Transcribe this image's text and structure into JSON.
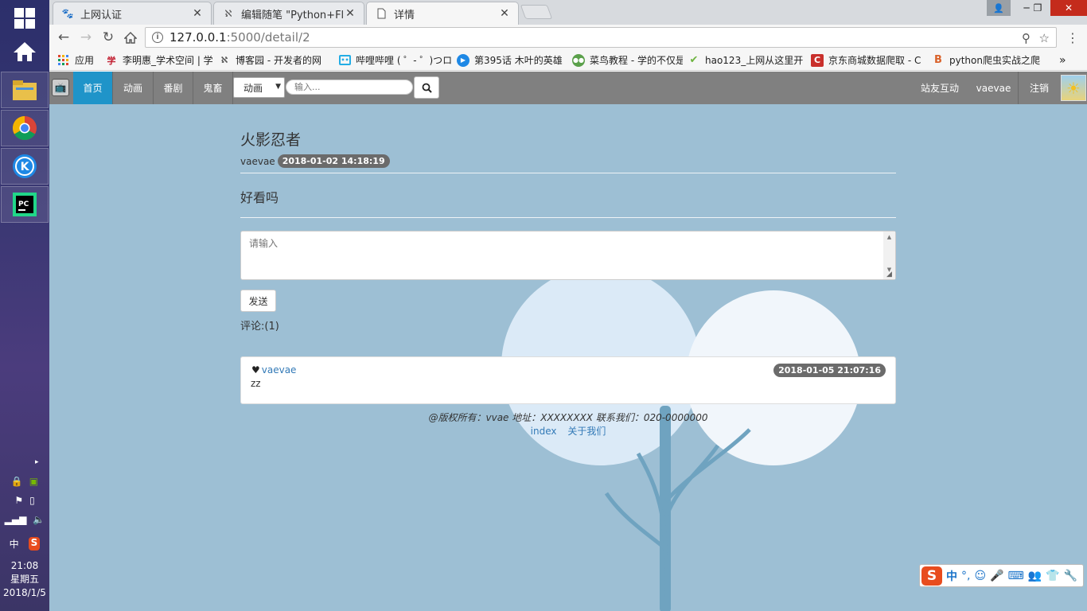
{
  "taskbar": {
    "clock_time": "21:08",
    "clock_weekday": "星期五",
    "clock_date": "2018/1/5",
    "tray_ime": "中",
    "tray_sogou": "S"
  },
  "browser": {
    "tabs": [
      {
        "title": "上网认证",
        "icon": "paw-icon"
      },
      {
        "title": "编辑随笔 \"Python+Flask",
        "icon": "cnblogs-icon"
      },
      {
        "title": "详情",
        "icon": "document-icon"
      }
    ],
    "url_host": "127.0.0.1",
    "url_path": ":5000/detail/2",
    "bookmarks": [
      {
        "label": "应用",
        "icon": "apps-grid-icon",
        "color": "#e0452f"
      },
      {
        "label": "李明惠_学术空间 | 学",
        "icon": "scholar-icon",
        "color": "#c0192c"
      },
      {
        "label": "博客园 - 开发者的网",
        "icon": "cnblogs-icon",
        "color": "#555555"
      },
      {
        "label": "哔哩哔哩 ( ゜- ゜)つロ",
        "icon": "bilibili-icon",
        "color": "#23ade5"
      },
      {
        "label": "第395话 木叶的英雄",
        "icon": "video-play-icon",
        "color": "#1e88e5"
      },
      {
        "label": "菜鸟教程 - 学的不仅是",
        "icon": "runoob-icon",
        "color": "#5aa04a"
      },
      {
        "label": "hao123_上网从这里开",
        "icon": "hao123-icon",
        "color": "#6db33f"
      },
      {
        "label": "京东商城数据爬取 - C",
        "icon": "csdn-icon",
        "color": "#c9302c"
      },
      {
        "label": "python爬虫实战之爬",
        "icon": "b-logo-icon",
        "color": "#d9622b"
      }
    ]
  },
  "navbar": {
    "items": [
      "首页",
      "动画",
      "番剧",
      "鬼畜"
    ],
    "select_value": "动画",
    "search_placeholder": "输入...",
    "right_items": [
      "站友互动",
      "vaevae",
      "注销"
    ]
  },
  "post": {
    "title": "火影忍者",
    "author": "vaevae",
    "time": "2018-01-02 14:18:19",
    "body": "好看吗"
  },
  "comment_form": {
    "placeholder": "请输入",
    "send_label": "发送"
  },
  "comments": {
    "heading": "评论:(1)",
    "items": [
      {
        "user": "vaevae",
        "time": "2018-01-05 21:07:16",
        "text": "zz"
      }
    ]
  },
  "footer": {
    "text": "@版权所有：vvae 地址：XXXXXXXX 联系我们：020-0000000",
    "links": [
      "index",
      "关于我们"
    ]
  },
  "ime_bar": {
    "logo": "S",
    "mode": "中",
    "punct": "°,"
  }
}
